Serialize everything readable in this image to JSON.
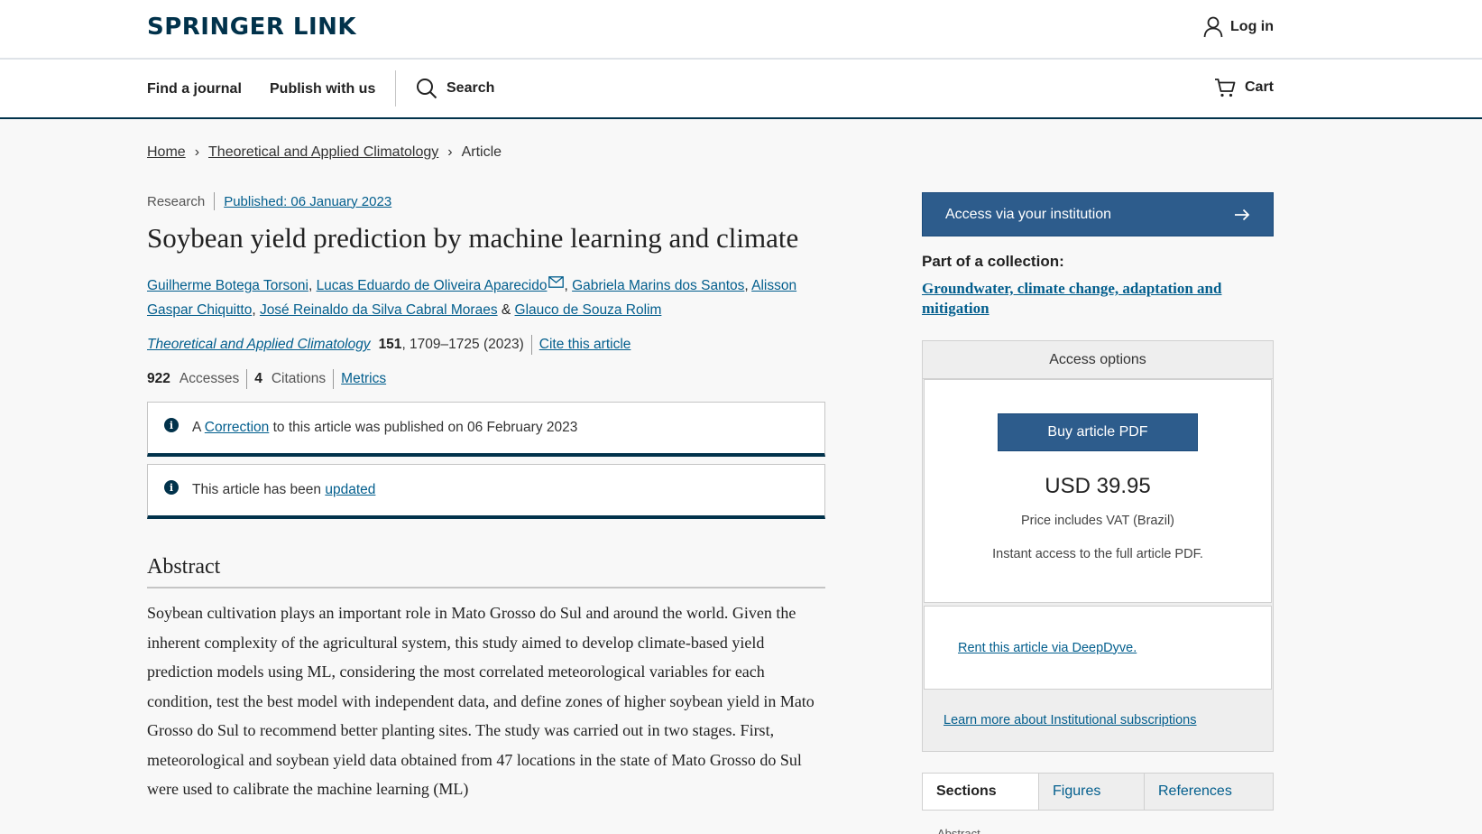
{
  "header": {
    "logo": "SPRINGER LINK",
    "login_label": "Log in"
  },
  "nav": {
    "find_journal": "Find a journal",
    "publish": "Publish with us",
    "search": "Search",
    "cart": "Cart"
  },
  "breadcrumb": {
    "home": "Home",
    "journal": "Theoretical and Applied Climatology",
    "current": "Article"
  },
  "article": {
    "type": "Research",
    "published": "Published: 06 January 2023",
    "title": "Soybean yield prediction by machine learning and climate",
    "authors": [
      "Guilherme Botega Torsoni",
      "Lucas Eduardo de Oliveira Aparecido",
      "Gabriela Marins dos Santos",
      "Alisson Gaspar Chiquitto",
      "José Reinaldo da Silva Cabral Moraes",
      "Glauco de Souza Rolim"
    ],
    "journal_name": "Theoretical and Applied Climatology",
    "volume": "151",
    "pages_year": ", 1709–1725 (2023)",
    "cite": "Cite this article",
    "accesses_count": "922",
    "accesses_label": "Accesses",
    "citations_count": "4",
    "citations_label": "Citations",
    "metrics_link": "Metrics"
  },
  "notices": {
    "correction_prefix": "A",
    "correction_link": "Correction",
    "correction_suffix": "to this article was published on 06 February 2023",
    "update_prefix": "This article has been",
    "update_link": "updated"
  },
  "abstract": {
    "heading": "Abstract",
    "text": "Soybean cultivation plays an important role in Mato Grosso do Sul and around the world. Given the inherent complexity of the agricultural system, this study aimed to develop climate-based yield prediction models using ML, considering the most correlated meteorological variables for each condition, test the best model with independent data, and define zones of higher soybean yield in Mato Grosso do Sul to recommend better planting sites. The study was carried out in two stages. First, meteorological and soybean yield data obtained from 47 locations in the state of Mato Grosso do Sul were used to calibrate the machine learning (ML)"
  },
  "sidebar": {
    "institution_button": "Access via your institution",
    "collection_label": "Part of a collection:",
    "collection_link": "Groundwater, climate change, adaptation and mitigation",
    "access_options": "Access options",
    "buy_button": "Buy article PDF",
    "price": "USD 39.95",
    "vat_note": "Price includes VAT (Brazil)",
    "instant_note": "Instant access to the full article PDF.",
    "rent_link": "Rent this article via DeepDyve.",
    "learn_link": "Learn more about Institutional subscriptions",
    "tabs": [
      "Sections",
      "Figures",
      "References"
    ],
    "tab_sub": "Abstract"
  },
  "colors": {
    "brand": "#01324b",
    "link": "#025e8d",
    "button": "#2d5c8c"
  }
}
